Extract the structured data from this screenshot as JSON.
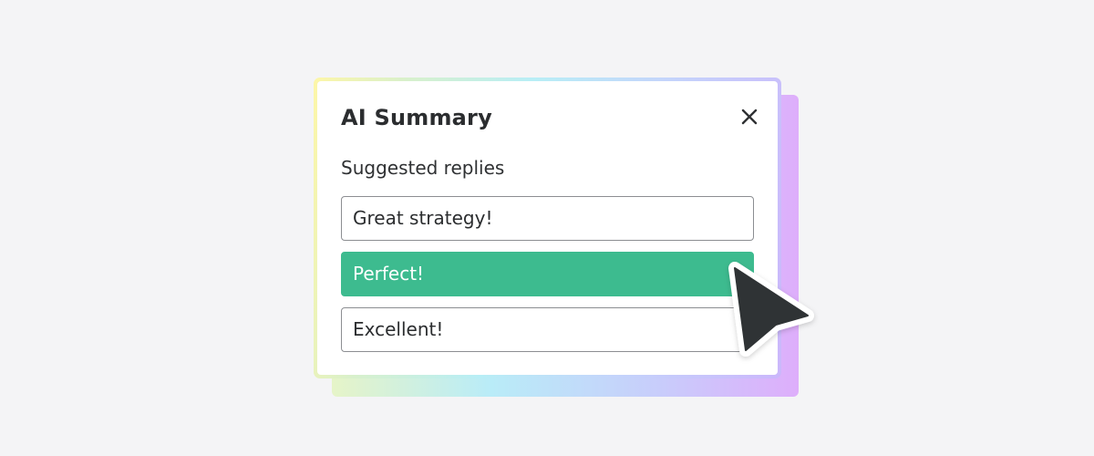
{
  "dialog": {
    "title": "AI Summary",
    "close_icon": "close-icon",
    "section_label": "Suggested replies",
    "replies": [
      {
        "label": "Great strategy!",
        "selected": false
      },
      {
        "label": "Perfect!",
        "selected": true
      },
      {
        "label": "Excellent!",
        "selected": false
      }
    ]
  },
  "colors": {
    "background": "#f4f4f6",
    "selected_reply": "#3dbb8f",
    "text": "#2b2d2f",
    "cursor": "#2f3335"
  },
  "pointer_icon": "mouse-pointer-icon"
}
